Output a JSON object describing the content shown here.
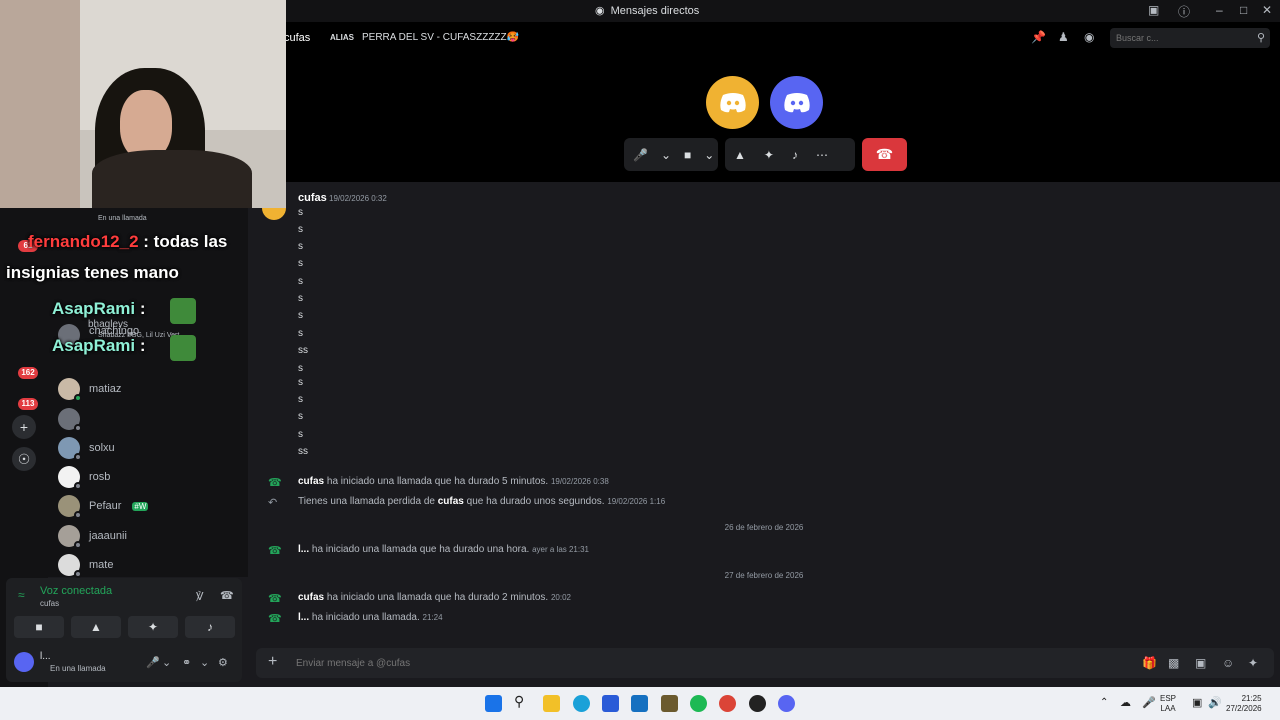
{
  "window": {
    "title": "Mensajes directos"
  },
  "rail": {
    "badges": [
      "61",
      "162",
      "113"
    ]
  },
  "dm_list": {
    "items": [
      {
        "name": "",
        "status": "En una llamada"
      },
      {
        "name": "bhagleys",
        "status": "Shabazz PBG, Lil Uzi Vert"
      },
      {
        "name": "chachingo"
      },
      {
        "name": "matiaz"
      },
      {
        "name": ""
      },
      {
        "name": "solxu"
      },
      {
        "name": "rosb"
      },
      {
        "name": "Pefaur",
        "tag": "#W"
      },
      {
        "name": "jaaaunii"
      },
      {
        "name": "mate"
      }
    ]
  },
  "voice_panel": {
    "status": "Voz conectada",
    "channel": "cufas",
    "user_name": "l...",
    "user_status": "En una llamada"
  },
  "header": {
    "name": "cufas",
    "alias_label": "ALIAS",
    "alias": "PERRA DEL SV - CUFASZZZZZ🥵",
    "search_placeholder": "Buscar c..."
  },
  "messages": {
    "author": "cufas",
    "time": "19/02/2026 0:32",
    "lines": [
      "s",
      "s",
      "s",
      "s",
      "s",
      "s",
      "s",
      "s",
      "ss",
      "s",
      "s",
      "s",
      "s",
      "s",
      "ss"
    ],
    "events": [
      {
        "user": "cufas",
        "text": "ha iniciado una llamada que ha durado 5 minutos.",
        "time": "19/02/2026 0:38"
      },
      {
        "prefix": "Tienes una llamada perdida de",
        "user": "cufas",
        "text": "que ha durado unos segundos.",
        "time": "19/02/2026 1:16"
      },
      {
        "user": "l...",
        "text": "ha iniciado una llamada que ha durado una hora.",
        "time": "ayer a las 21:31"
      },
      {
        "user": "cufas",
        "text": "ha iniciado una llamada que ha durado 2 minutos.",
        "time": "20:02"
      },
      {
        "user": "l...",
        "text": "ha iniciado una llamada.",
        "time": "21:24"
      }
    ],
    "dividers": [
      "26 de febrero de 2026",
      "27 de febrero de 2026"
    ]
  },
  "composer": {
    "placeholder": "Enviar mensaje a @cufas"
  },
  "overlay_chat": {
    "line1_name": "fernando12_2",
    "line1_text": ": todas las",
    "line2_text": "insignias tenes mano",
    "line3_name": "AsapRami",
    "line3_sep": ":",
    "line4_name": "AsapRami",
    "line4_sep": ":"
  },
  "taskbar": {
    "lang_top": "ESP",
    "lang_bottom": "LAA",
    "time": "21:25",
    "date": "27/2/2026"
  }
}
